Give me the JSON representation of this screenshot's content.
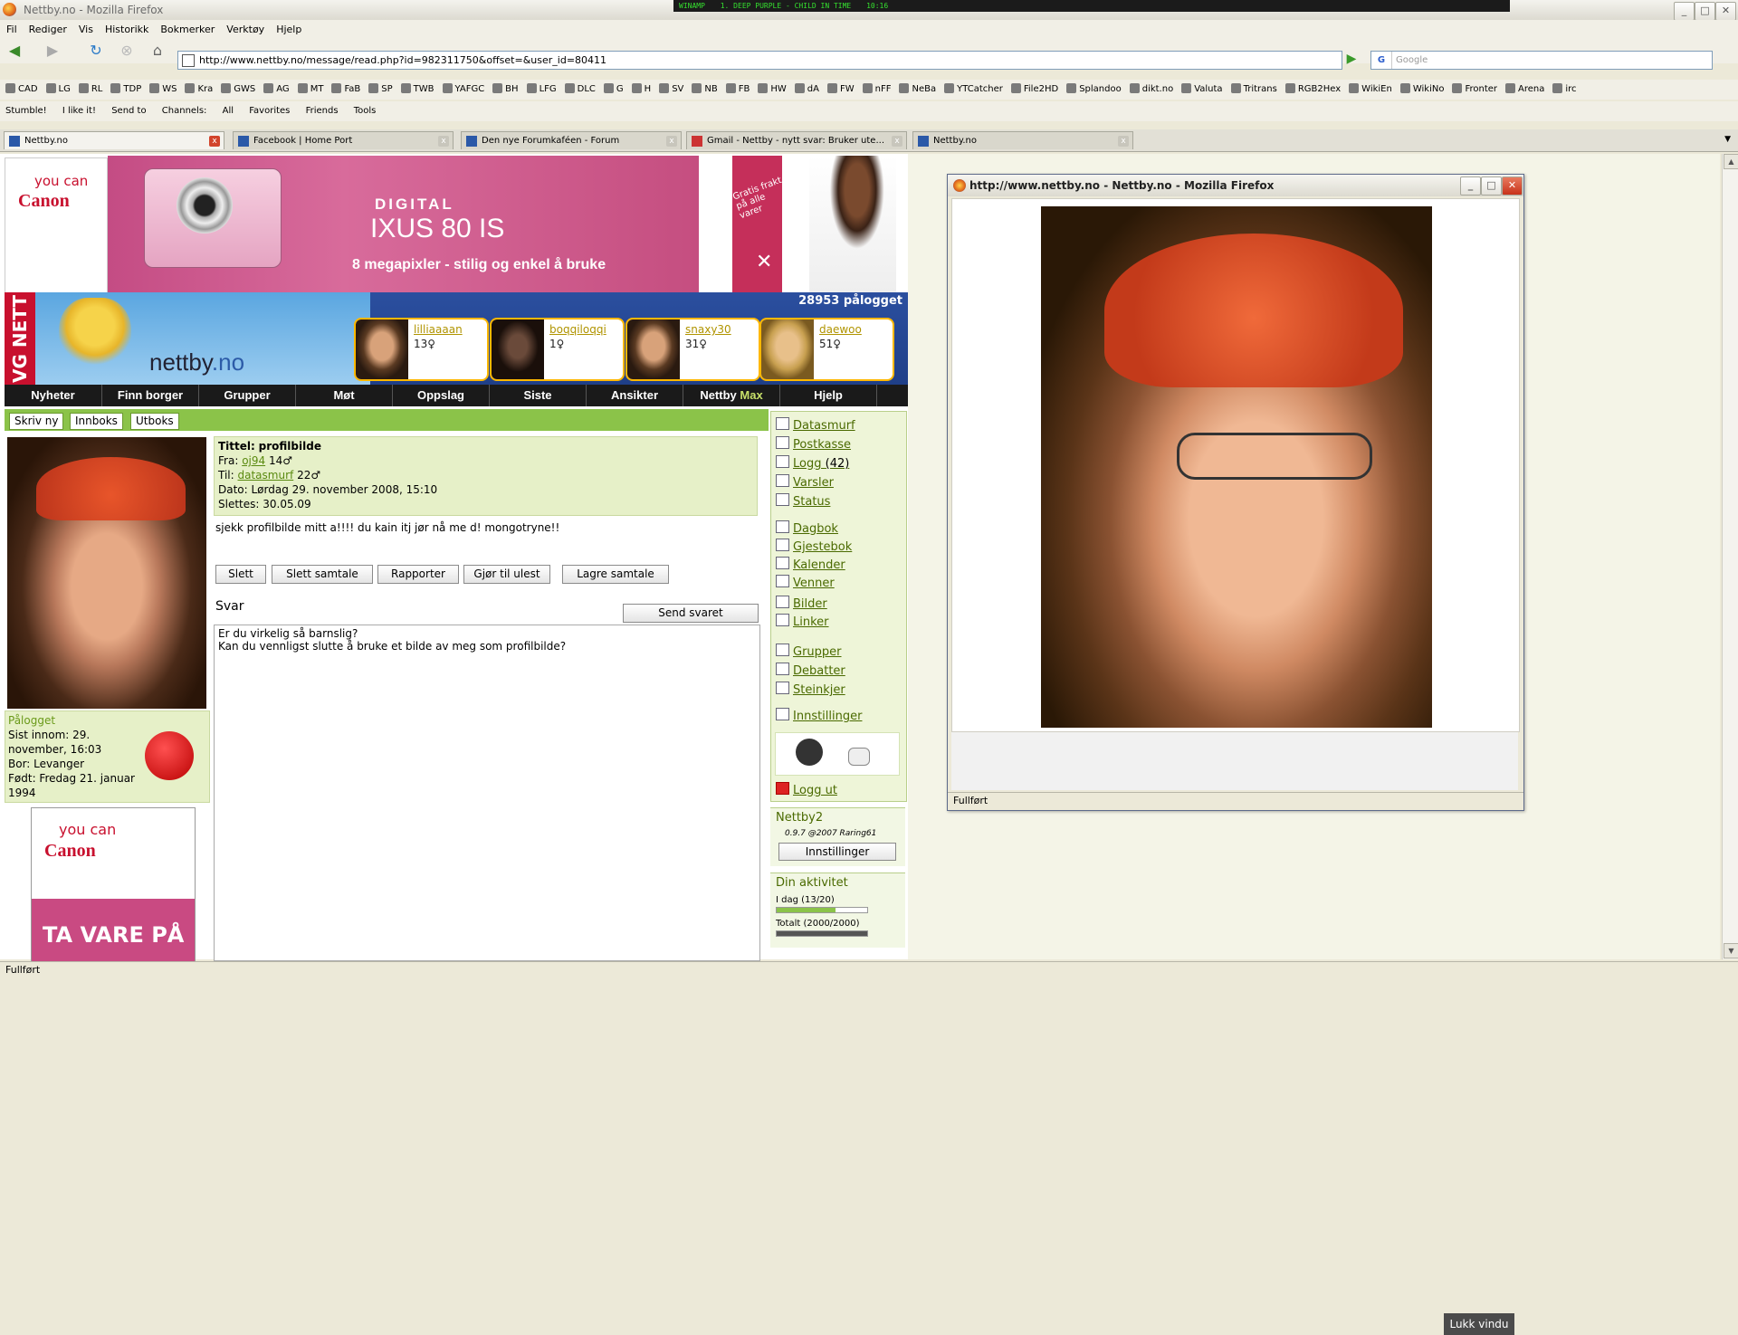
{
  "browser": {
    "title": "Nettby.no - Mozilla Firefox",
    "winamp_text": [
      "WINAMP",
      "1. DEEP PURPLE - CHILD IN TIME",
      "10:16"
    ],
    "menu": [
      "Fil",
      "Rediger",
      "Vis",
      "Historikk",
      "Bokmerker",
      "Verktøy",
      "Hjelp"
    ],
    "url": "http://www.nettby.no/message/read.php?id=982311750&offset=&user_id=80411",
    "search_placeholder": "Google",
    "bookmarks": [
      "CAD",
      "LG",
      "RL",
      "TDP",
      "WS",
      "Kra",
      "GWS",
      "AG",
      "MT",
      "FaB",
      "SP",
      "TWB",
      "YAFGC",
      "BH",
      "LFG",
      "DLC",
      "G",
      "H",
      "SV",
      "NB",
      "FB",
      "HW",
      "dA",
      "FW",
      "nFF",
      "NeBa",
      "YTCatcher",
      "File2HD",
      "Splandoo",
      "dikt.no",
      "Valuta",
      "Tritrans",
      "RGB2Hex",
      "WikiEn",
      "WikiNo",
      "Fronter",
      "Arena",
      "irc"
    ],
    "stumble": [
      "Stumble!",
      "I like it!",
      "Send to",
      "Channels:",
      "All",
      "Favorites",
      "Friends",
      "Tools"
    ],
    "tabs": [
      {
        "label": "Nettby.no"
      },
      {
        "label": "Facebook | Home Port"
      },
      {
        "label": "Den nye Forumkaféen - Forum"
      },
      {
        "label": "Gmail - Nettby - nytt svar: Bruker ute..."
      },
      {
        "label": "Nettby.no"
      }
    ],
    "status": "Fullført"
  },
  "ads": {
    "canon_small": "you can",
    "canon_brand": "Canon",
    "camera_line1": "DIGITAL",
    "camera_line2": "IXUS 80 IS",
    "camera_line3": "8 megapixler - stilig og enkel å bruke",
    "right_ad": "Gratis frakt på alle varer",
    "bottom_line1": "you can",
    "bottom_brand": "Canon",
    "bottom_line3": "TA VARE PÅ"
  },
  "header": {
    "logo_part1": "nettby",
    "logo_part2": ".no",
    "vg": "VG NETT",
    "online": "28953 pålogget",
    "users": [
      {
        "name": "lilliaaaan",
        "age": "13♀"
      },
      {
        "name": "boqqiloqqi",
        "age": "1♀"
      },
      {
        "name": "snaxy30",
        "age": "31♀"
      },
      {
        "name": "daewoo",
        "age": "51♀"
      }
    ]
  },
  "nav": [
    {
      "label": "Nyheter"
    },
    {
      "label": "Finn borger"
    },
    {
      "label": "Grupper"
    },
    {
      "label": "Møt"
    },
    {
      "label": "Oppslag"
    },
    {
      "label": "Siste"
    },
    {
      "label": "Ansikter"
    },
    {
      "label": "Nettby",
      "extra": "Max"
    },
    {
      "label": "Hjelp"
    }
  ],
  "subnav": [
    "Skriv ny",
    "Innboks",
    "Utboks"
  ],
  "profile": {
    "status": "Pålogget",
    "last_seen": "Sist innom: 29. november, 16:03",
    "lives": "Bor: Levanger",
    "born": "Født: Fredag 21. januar 1994"
  },
  "message": {
    "title_label": "Tittel:",
    "title": "profilbilde",
    "from_label": "Fra:",
    "from_user": "oj94",
    "from_age": "14♂",
    "to_label": "Til:",
    "to_user": "datasmurf",
    "to_age": "22♂",
    "date": "Dato: Lørdag 29. november 2008, 15:10",
    "delete_date": "Slettes: 30.05.09",
    "body": "sjekk profilbilde mitt a!!!! du kain itj jør nå me d! mongotryne!!",
    "buttons": [
      "Slett",
      "Slett samtale",
      "Rapporter",
      "Gjør til ulest",
      "Lagre samtale"
    ],
    "reply_heading": "Svar",
    "send_button": "Send svaret",
    "reply_text": "Er du virkelig så barnslig?\nKan du vennligst slutte å bruke et bilde av meg som profilbilde?"
  },
  "sidebar": {
    "items": [
      {
        "label": "Datasmurf"
      },
      {
        "label": "Postkasse"
      },
      {
        "label": "Logg",
        "count": "(42)"
      },
      {
        "label": "Varsler"
      },
      {
        "label": "Status"
      },
      {
        "label": "Dagbok"
      },
      {
        "label": "Gjestebok"
      },
      {
        "label": "Kalender"
      },
      {
        "label": "Venner"
      },
      {
        "label": "Bilder"
      },
      {
        "label": "Linker"
      },
      {
        "label": "Grupper"
      },
      {
        "label": "Debatter"
      },
      {
        "label": "Steinkjer"
      },
      {
        "label": "Innstillinger"
      }
    ],
    "logout": "Logg ut",
    "nettby2_title": "Nettby2",
    "nettby2_version": "0.9.7 @2007 Raring61",
    "nettby2_button": "Innstillinger",
    "activity_title": "Din aktivitet",
    "activity_today": "I dag (13/20)",
    "activity_total": "Totalt (2000/2000)",
    "today_fraction": 0.65,
    "total_fraction": 1.0
  },
  "popup": {
    "title": "http://www.nettby.no - Nettby.no - Mozilla Firefox",
    "close_button": "Lukk vindu",
    "status": "Fullført"
  }
}
